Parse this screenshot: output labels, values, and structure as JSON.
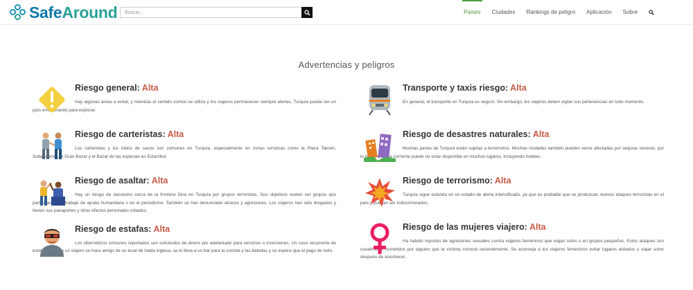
{
  "header": {
    "logo_safe": "Safe",
    "logo_around": "Around",
    "search_placeholder": "Buscar...",
    "nav": [
      {
        "label": "Países",
        "active": true
      },
      {
        "label": "Ciudades",
        "active": false
      },
      {
        "label": "Rankings de peligro",
        "active": false
      },
      {
        "label": "Aplicación",
        "active": false
      },
      {
        "label": "Sobre",
        "active": false
      }
    ]
  },
  "main": {
    "title": "Advertencias y peligros",
    "left": [
      {
        "title": "Riesgo general: ",
        "level": "Alta",
        "icon": "warning-sign-icon",
        "text": "Hay algunas áreas a evitar, y mientras el sentido común se utiliza y los viajeros permanecen siempre alertas, Turquía puede ser un país emocionante para explorar."
      },
      {
        "title": "Riesgo de carteristas: ",
        "level": "Alta",
        "icon": "pickpocket-icon",
        "text": "Los carteristas y los robos de sacos son comunes en Turquía, especialmente en zonas turísticas como la Plaza Taksim, Sultanahmet, el Gran Bazar y el Bazar de las especias en Estambul."
      },
      {
        "title": "Riesgo de asaltar: ",
        "level": "Alta",
        "icon": "mugging-icon",
        "text": "Hay un riesgo de secuestro cerca de la frontera Siria en Turquía por grupos terroristas. Sus objetivos suelen ser grupos que participan en el trabajo de ayuda humanitaria o en el periodismo. También se han denunciado atracos y agresiones. Los viajeros han sido drogados y tienen sus pasaportes y otros efectos personales robados."
      },
      {
        "title": "Riesgo de estafas: ",
        "level": "Alta",
        "icon": "scammer-icon",
        "text": "Los cibernéticos comunes reportados son solicitudes de dinero por adelantado para servicios o inversiones. Un caso recurrente de estafa es el que un viajero se hace amigo de un local de habla inglesa, se le lleva a un bar para la comida y las bebidas y se espera que el pago de todo."
      }
    ],
    "right": [
      {
        "title": "Transporte y taxis riesgo: ",
        "level": "Alta",
        "icon": "train-icon",
        "text": "En general, el transporte en Turquía es seguro. Sin embargo, los viajeros deben vigilar sus pertenencias en todo momento."
      },
      {
        "title": "Riesgo de desastres naturales: ",
        "level": "Alta",
        "icon": "collapsed-buildings-icon",
        "text": "Muchas partes de Turquía están sujetas a terremotos. Muchas ciudades también pueden verse afectadas por sequías severas; por lo tanto, el agua corriente puede no estar disponible en muchos lugares, incluyendo hoteles."
      },
      {
        "title": "Riesgo de terrorismo: ",
        "level": "Alta",
        "icon": "explosion-icon",
        "text": "Turquía sigue estando en un estado de alerta intensificado, ya que es probable que se produzcan nuevos ataques terroristas en el país y puedan ser indiscriminados."
      },
      {
        "title": "Riesgo de las mujeres viajero: ",
        "level": "Alta",
        "icon": "female-symbol-icon",
        "text": "Ha habido reportes de agresiones sexuales contra viajeros femeninos que viajan solos o en grupos pequeños. Estos ataques son usualmente cometidos por alguien que la víctima conoció recientemente. Se aconseja a los viajeros femeninos evitar lugares aislados y viajar solos después de anochecer."
      }
    ],
    "colors": {
      "risk_level": "#c75a45",
      "nav_active": "#4d9b3e",
      "logo_blue": "#0f79a8",
      "logo_teal": "#2aa198"
    }
  }
}
